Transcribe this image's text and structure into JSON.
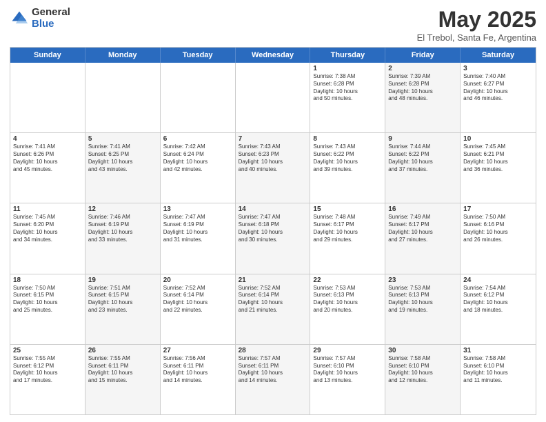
{
  "logo": {
    "general": "General",
    "blue": "Blue"
  },
  "title": "May 2025",
  "subtitle": "El Trebol, Santa Fe, Argentina",
  "header_days": [
    "Sunday",
    "Monday",
    "Tuesday",
    "Wednesday",
    "Thursday",
    "Friday",
    "Saturday"
  ],
  "weeks": [
    [
      {
        "day": "",
        "text": "",
        "shaded": false,
        "empty": true
      },
      {
        "day": "",
        "text": "",
        "shaded": false,
        "empty": true
      },
      {
        "day": "",
        "text": "",
        "shaded": false,
        "empty": true
      },
      {
        "day": "",
        "text": "",
        "shaded": false,
        "empty": true
      },
      {
        "day": "1",
        "text": "Sunrise: 7:38 AM\nSunset: 6:28 PM\nDaylight: 10 hours\nand 50 minutes.",
        "shaded": false
      },
      {
        "day": "2",
        "text": "Sunrise: 7:39 AM\nSunset: 6:28 PM\nDaylight: 10 hours\nand 48 minutes.",
        "shaded": true
      },
      {
        "day": "3",
        "text": "Sunrise: 7:40 AM\nSunset: 6:27 PM\nDaylight: 10 hours\nand 46 minutes.",
        "shaded": false
      }
    ],
    [
      {
        "day": "4",
        "text": "Sunrise: 7:41 AM\nSunset: 6:26 PM\nDaylight: 10 hours\nand 45 minutes.",
        "shaded": false
      },
      {
        "day": "5",
        "text": "Sunrise: 7:41 AM\nSunset: 6:25 PM\nDaylight: 10 hours\nand 43 minutes.",
        "shaded": true
      },
      {
        "day": "6",
        "text": "Sunrise: 7:42 AM\nSunset: 6:24 PM\nDaylight: 10 hours\nand 42 minutes.",
        "shaded": false
      },
      {
        "day": "7",
        "text": "Sunrise: 7:43 AM\nSunset: 6:23 PM\nDaylight: 10 hours\nand 40 minutes.",
        "shaded": true
      },
      {
        "day": "8",
        "text": "Sunrise: 7:43 AM\nSunset: 6:22 PM\nDaylight: 10 hours\nand 39 minutes.",
        "shaded": false
      },
      {
        "day": "9",
        "text": "Sunrise: 7:44 AM\nSunset: 6:22 PM\nDaylight: 10 hours\nand 37 minutes.",
        "shaded": true
      },
      {
        "day": "10",
        "text": "Sunrise: 7:45 AM\nSunset: 6:21 PM\nDaylight: 10 hours\nand 36 minutes.",
        "shaded": false
      }
    ],
    [
      {
        "day": "11",
        "text": "Sunrise: 7:45 AM\nSunset: 6:20 PM\nDaylight: 10 hours\nand 34 minutes.",
        "shaded": false
      },
      {
        "day": "12",
        "text": "Sunrise: 7:46 AM\nSunset: 6:19 PM\nDaylight: 10 hours\nand 33 minutes.",
        "shaded": true
      },
      {
        "day": "13",
        "text": "Sunrise: 7:47 AM\nSunset: 6:19 PM\nDaylight: 10 hours\nand 31 minutes.",
        "shaded": false
      },
      {
        "day": "14",
        "text": "Sunrise: 7:47 AM\nSunset: 6:18 PM\nDaylight: 10 hours\nand 30 minutes.",
        "shaded": true
      },
      {
        "day": "15",
        "text": "Sunrise: 7:48 AM\nSunset: 6:17 PM\nDaylight: 10 hours\nand 29 minutes.",
        "shaded": false
      },
      {
        "day": "16",
        "text": "Sunrise: 7:49 AM\nSunset: 6:17 PM\nDaylight: 10 hours\nand 27 minutes.",
        "shaded": true
      },
      {
        "day": "17",
        "text": "Sunrise: 7:50 AM\nSunset: 6:16 PM\nDaylight: 10 hours\nand 26 minutes.",
        "shaded": false
      }
    ],
    [
      {
        "day": "18",
        "text": "Sunrise: 7:50 AM\nSunset: 6:15 PM\nDaylight: 10 hours\nand 25 minutes.",
        "shaded": false
      },
      {
        "day": "19",
        "text": "Sunrise: 7:51 AM\nSunset: 6:15 PM\nDaylight: 10 hours\nand 23 minutes.",
        "shaded": true
      },
      {
        "day": "20",
        "text": "Sunrise: 7:52 AM\nSunset: 6:14 PM\nDaylight: 10 hours\nand 22 minutes.",
        "shaded": false
      },
      {
        "day": "21",
        "text": "Sunrise: 7:52 AM\nSunset: 6:14 PM\nDaylight: 10 hours\nand 21 minutes.",
        "shaded": true
      },
      {
        "day": "22",
        "text": "Sunrise: 7:53 AM\nSunset: 6:13 PM\nDaylight: 10 hours\nand 20 minutes.",
        "shaded": false
      },
      {
        "day": "23",
        "text": "Sunrise: 7:53 AM\nSunset: 6:13 PM\nDaylight: 10 hours\nand 19 minutes.",
        "shaded": true
      },
      {
        "day": "24",
        "text": "Sunrise: 7:54 AM\nSunset: 6:12 PM\nDaylight: 10 hours\nand 18 minutes.",
        "shaded": false
      }
    ],
    [
      {
        "day": "25",
        "text": "Sunrise: 7:55 AM\nSunset: 6:12 PM\nDaylight: 10 hours\nand 17 minutes.",
        "shaded": false
      },
      {
        "day": "26",
        "text": "Sunrise: 7:55 AM\nSunset: 6:11 PM\nDaylight: 10 hours\nand 15 minutes.",
        "shaded": true
      },
      {
        "day": "27",
        "text": "Sunrise: 7:56 AM\nSunset: 6:11 PM\nDaylight: 10 hours\nand 14 minutes.",
        "shaded": false
      },
      {
        "day": "28",
        "text": "Sunrise: 7:57 AM\nSunset: 6:11 PM\nDaylight: 10 hours\nand 14 minutes.",
        "shaded": true
      },
      {
        "day": "29",
        "text": "Sunrise: 7:57 AM\nSunset: 6:10 PM\nDaylight: 10 hours\nand 13 minutes.",
        "shaded": false
      },
      {
        "day": "30",
        "text": "Sunrise: 7:58 AM\nSunset: 6:10 PM\nDaylight: 10 hours\nand 12 minutes.",
        "shaded": true
      },
      {
        "day": "31",
        "text": "Sunrise: 7:58 AM\nSunset: 6:10 PM\nDaylight: 10 hours\nand 11 minutes.",
        "shaded": false
      }
    ]
  ]
}
